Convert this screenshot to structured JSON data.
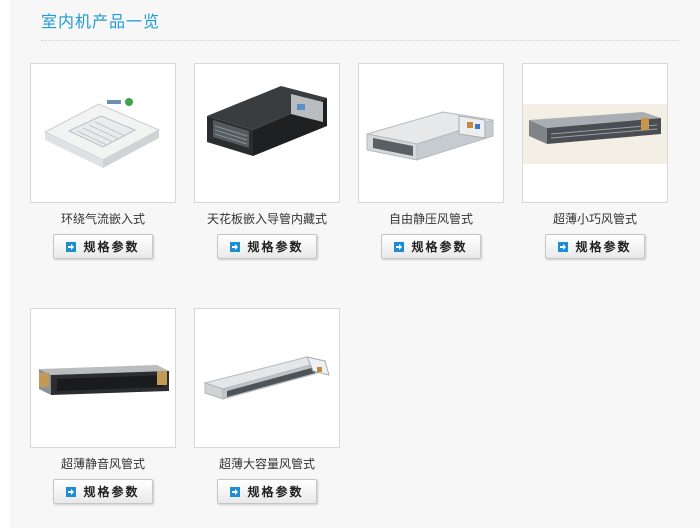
{
  "section": {
    "title": "室内机产品一览"
  },
  "products": [
    {
      "name": "环绕气流嵌入式",
      "button": "规格参数",
      "icon": "arrow-right-icon"
    },
    {
      "name": "天花板嵌入导管内藏式",
      "button": "规格参数",
      "icon": "arrow-right-icon"
    },
    {
      "name": "自由静压风管式",
      "button": "规格参数",
      "icon": "arrow-right-icon"
    },
    {
      "name": "超薄小巧风管式",
      "button": "规格参数",
      "icon": "arrow-right-icon"
    },
    {
      "name": "超薄静音风管式",
      "button": "规格参数",
      "icon": "arrow-right-icon"
    },
    {
      "name": "超薄大容量风管式",
      "button": "规格参数",
      "icon": "arrow-right-icon"
    }
  ],
  "colors": {
    "title": "#1e9ad6",
    "icon": "#1b8fd2"
  }
}
